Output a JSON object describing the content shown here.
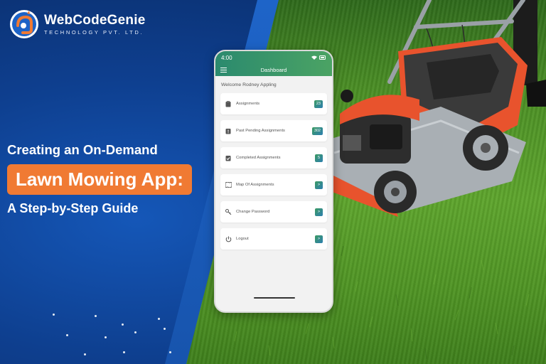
{
  "brand": {
    "name": "WebCodeGenie",
    "tagline": "TECHNOLOGY PVT. LTD."
  },
  "headline": {
    "line1": "Creating an On-Demand",
    "line2": "Lawn Mowing App:",
    "line3": "A Step-by-Step Guide"
  },
  "colors": {
    "navy": "#0a2a63",
    "blue": "#1557b8",
    "accent_orange": "#f07a33",
    "app_green": "#3b9a62",
    "grass": "#5ea52d"
  },
  "phone": {
    "status_time": "4:00",
    "title": "Dashboard",
    "welcome": "Welcome Rodney Appling",
    "items": [
      {
        "label": "Assignments",
        "badge": "23",
        "icon": "clipboard-icon"
      },
      {
        "label": "Past Pending Assignments",
        "badge": "302",
        "icon": "pending-icon"
      },
      {
        "label": "Completed Assignments",
        "badge": "5",
        "icon": "check-clipboard-icon"
      },
      {
        "label": "Map Of Assignments",
        "badge": ">",
        "icon": "map-icon"
      },
      {
        "label": "Change Password",
        "badge": ">",
        "icon": "key-icon"
      },
      {
        "label": "Logout",
        "badge": ">",
        "icon": "power-icon"
      }
    ]
  }
}
